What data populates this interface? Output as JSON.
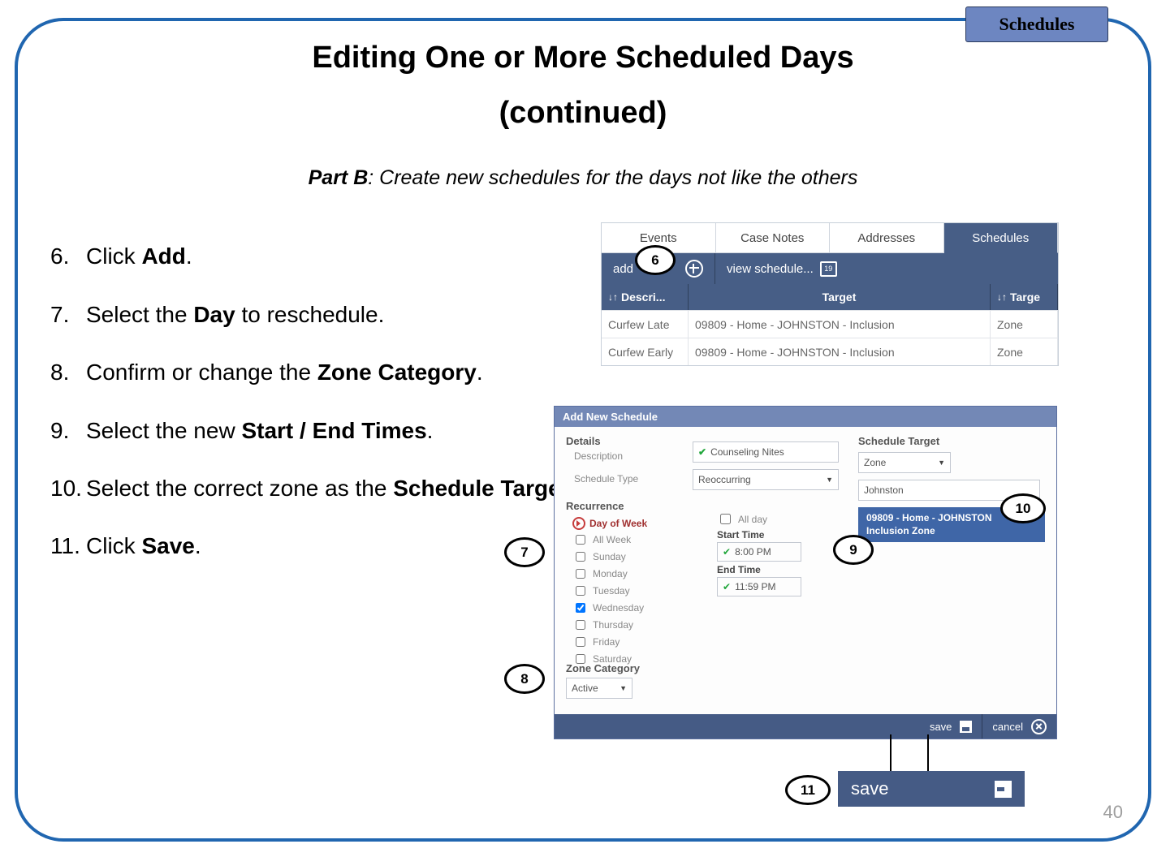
{
  "tab_label": "Schedules",
  "title": "Editing One or More Scheduled Days",
  "subtitle": "(continued)",
  "partb_label": "Part B",
  "partb_text": ": Create new schedules for the days not like the others",
  "steps": [
    {
      "n": "6.",
      "pre": "Click ",
      "bold": "Add",
      "post": "."
    },
    {
      "n": "7.",
      "pre": "Select the ",
      "bold": "Day",
      "post": " to reschedule."
    },
    {
      "n": "8.",
      "pre": "Confirm or change the ",
      "bold": "Zone Category",
      "post": "."
    },
    {
      "n": "9.",
      "pre": "Select the new ",
      "bold": "Start / End Times",
      "post": "."
    },
    {
      "n": "10.",
      "pre": "Select the correct zone as the ",
      "bold": "Schedule Target",
      "post": "."
    },
    {
      "n": "11.",
      "pre": "Click ",
      "bold": "Save",
      "post": "."
    }
  ],
  "page_number": "40",
  "callouts": {
    "c6": "6",
    "c7": "7",
    "c8": "8",
    "c9": "9",
    "c10": "10",
    "c11": "11"
  },
  "panel1": {
    "tabs": [
      "Events",
      "Case Notes",
      "Addresses",
      "Schedules"
    ],
    "toolbar": {
      "add": "add",
      "view": "view schedule...",
      "cal": "19"
    },
    "headers": {
      "h1": "Descri...",
      "h2": "Target",
      "h3": "Targe"
    },
    "rows": [
      {
        "c1": "Curfew Late",
        "c2": "09809 - Home - JOHNSTON - Inclusion",
        "c3": "Zone"
      },
      {
        "c1": "Curfew Early",
        "c2": "09809 - Home - JOHNSTON - Inclusion",
        "c3": "Zone"
      }
    ]
  },
  "panel2": {
    "title": "Add New Schedule",
    "details_h": "Details",
    "desc_lbl": "Description",
    "desc_val": "Counseling Nites",
    "st_lbl": "Schedule Type",
    "st_val": "Reoccurring",
    "target_h": "Schedule Target",
    "target_type": "Zone",
    "target_name": "Johnston",
    "zone_picked": "09809 - Home - JOHNSTON Inclusion Zone",
    "recur_h": "Recurrence",
    "dow_h": "Day of Week",
    "days": [
      "All Week",
      "Sunday",
      "Monday",
      "Tuesday",
      "Wednesday",
      "Thursday",
      "Friday",
      "Saturday"
    ],
    "checked_day": "Wednesday",
    "allday": "All day",
    "start_lbl": "Start Time",
    "start_val": "8:00 PM",
    "end_lbl": "End Time",
    "end_val": "11:59 PM",
    "zc_h": "Zone Category",
    "zc_val": "Active",
    "save": "save",
    "cancel": "cancel",
    "save_zoom": "save"
  }
}
